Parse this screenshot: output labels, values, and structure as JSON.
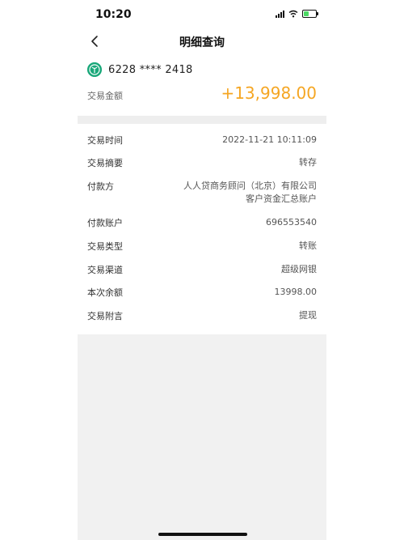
{
  "status": {
    "time": "10:20"
  },
  "nav": {
    "title": "明细查询"
  },
  "card": {
    "number": "6228 **** 2418"
  },
  "amount": {
    "label": "交易金额",
    "value": "+13,998.00",
    "color": "#f5a623"
  },
  "details": [
    {
      "label": "交易时间",
      "value": "2022-11-21 10:11:09"
    },
    {
      "label": "交易摘要",
      "value": "转存"
    },
    {
      "label": "付款方",
      "value": "人人贷商务顾问（北京）有限公司",
      "value2": "客户资金汇总账户"
    },
    {
      "label": "付款账户",
      "value": "696553540"
    },
    {
      "label": "交易类型",
      "value": "转账"
    },
    {
      "label": "交易渠道",
      "value": "超级网银"
    },
    {
      "label": "本次余额",
      "value": "13998.00"
    },
    {
      "label": "交易附言",
      "value": "提现"
    }
  ],
  "icons": {
    "back": "chevron-left-icon",
    "bank": "bank-logo-icon",
    "signal": "cellular-signal-icon",
    "wifi": "wifi-icon",
    "battery": "battery-charging-icon"
  },
  "battery_level": 0.45
}
